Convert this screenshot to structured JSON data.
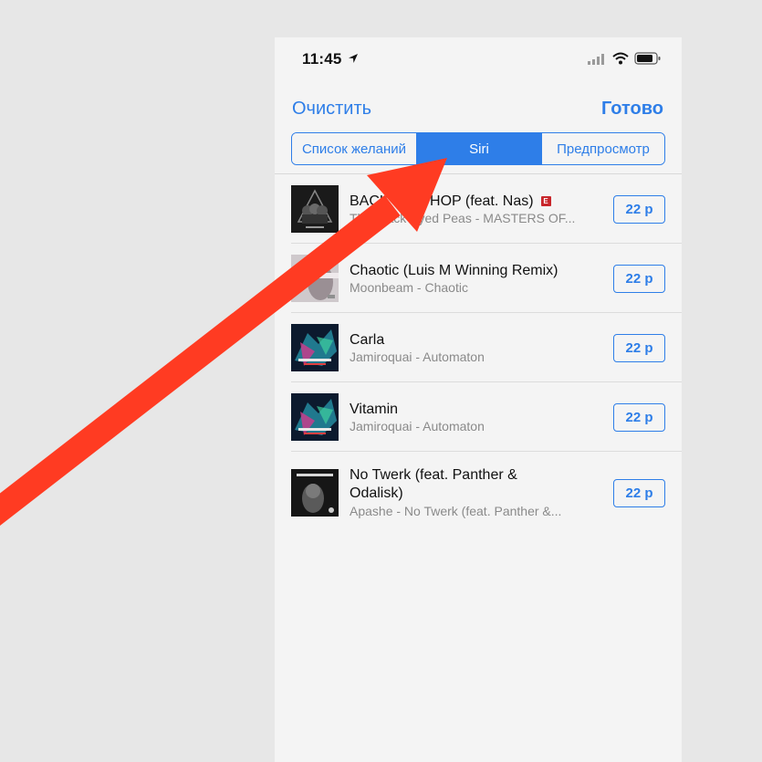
{
  "status": {
    "time": "11:45"
  },
  "nav": {
    "clear_label": "Очистить",
    "done_label": "Готово"
  },
  "tabs": [
    {
      "label": "Список желаний",
      "active": false
    },
    {
      "label": "Siri",
      "active": true
    },
    {
      "label": "Предпросмотр",
      "active": false
    }
  ],
  "tracks": [
    {
      "title": "BACK 2 HIPHOP (feat. Nas)",
      "subtitle": "The Black Eyed Peas - MASTERS OF...",
      "explicit_badge": "E",
      "price": "22 р",
      "art": "album-art-masters"
    },
    {
      "title": "Chaotic (Luis M Winning Remix)",
      "subtitle": "Moonbeam - Chaotic",
      "price": "22 р",
      "art": "album-art-moonbeam"
    },
    {
      "title": "Carla",
      "subtitle": "Jamiroquai - Automaton",
      "price": "22 р",
      "art": "album-art-automaton"
    },
    {
      "title": "Vitamin",
      "subtitle": "Jamiroquai - Automaton",
      "price": "22 р",
      "art": "album-art-automaton"
    },
    {
      "title": "No Twerk (feat. Panther & Odalisk)",
      "subtitle": "Apashe - No Twerk (feat. Panther &...",
      "price": "22 р",
      "art": "album-art-no-twerk"
    }
  ],
  "colors": {
    "accent": "#2e7ee8",
    "annotation_arrow": "#ff3b22",
    "explicit": "#c8262b"
  },
  "annotation": {
    "type": "arrow",
    "points_to": "Siri tab"
  }
}
